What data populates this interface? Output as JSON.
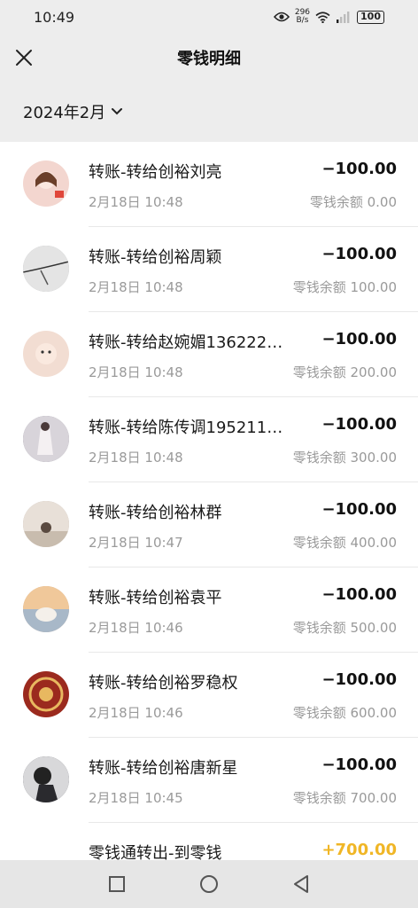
{
  "status_bar": {
    "time": "10:49",
    "speed_value": "296",
    "speed_unit": "B/s",
    "battery": "100"
  },
  "header": {
    "title": "零钱明细"
  },
  "filter": {
    "month": "2024年2月"
  },
  "transactions": [
    {
      "title": "转账-转给创裕刘亮",
      "time": "2月18日 10:48",
      "amount": "−100.00",
      "balance": "零钱余额 0.00",
      "avatar_color": "#f3d6cf"
    },
    {
      "title": "转账-转给创裕周颖",
      "time": "2月18日 10:48",
      "amount": "−100.00",
      "balance": "零钱余额 100.00",
      "avatar_color": "#9ea1a3"
    },
    {
      "title": "转账-转给赵婉媚136222…",
      "time": "2月18日 10:48",
      "amount": "−100.00",
      "balance": "零钱余额 200.00",
      "avatar_color": "#f2ddd2"
    },
    {
      "title": "转账-转给陈传调195211…",
      "time": "2月18日 10:48",
      "amount": "−100.00",
      "balance": "零钱余额 300.00",
      "avatar_color": "#7c7a86"
    },
    {
      "title": "转账-转给创裕林群",
      "time": "2月18日 10:47",
      "amount": "−100.00",
      "balance": "零钱余额 400.00",
      "avatar_color": "#b5aaa0"
    },
    {
      "title": "转账-转给创裕袁平",
      "time": "2月18日 10:46",
      "amount": "−100.00",
      "balance": "零钱余额 500.00",
      "avatar_color": "#c9a58a"
    },
    {
      "title": "转账-转给创裕罗稳权",
      "time": "2月18日 10:46",
      "amount": "−100.00",
      "balance": "零钱余额 600.00",
      "avatar_color": "#9b2a1e"
    },
    {
      "title": "转账-转给创裕唐新星",
      "time": "2月18日 10:45",
      "amount": "−100.00",
      "balance": "零钱余额 700.00",
      "avatar_color": "#3a3a40"
    },
    {
      "title": "零钱通转出-到零钱",
      "time": "",
      "amount": "+700.00",
      "balance": "",
      "avatar_color": "#f0b626"
    }
  ]
}
